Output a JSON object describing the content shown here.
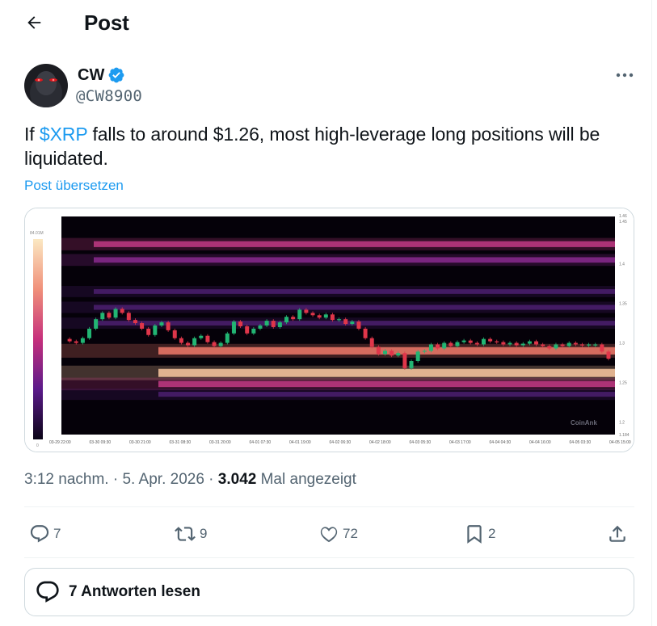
{
  "header": {
    "title": "Post",
    "back_icon": "arrow-left-icon"
  },
  "author": {
    "name": "CW",
    "handle": "@CW8900",
    "verified_color": "#1d9bf0"
  },
  "tweet": {
    "text_before": "If ",
    "cashtag": "$XRP",
    "text_after": " falls to around $1.26, most high-leverage long positions will be liquidated.",
    "translate_label": "Post übersetzen"
  },
  "chart_data": {
    "type": "heatmap",
    "watermark": "CoinAnk",
    "colorbar_max_label": "84.01M",
    "colorbar_min_label": "0",
    "x_tick_labels": [
      "03-29 22:00",
      "03-30 09:30",
      "03-30 21:00",
      "03-31 08:30",
      "03-31 20:00",
      "04-01 07:30",
      "04-01 19:00",
      "04-02 06:30",
      "04-02 18:00",
      "04-03 05:30",
      "04-03 17:00",
      "04-04 04:30",
      "04-04 16:00",
      "04-05 03:30",
      "04-05 15:00"
    ],
    "y_tick_labels": [
      "1.46",
      "1.45",
      "1.4",
      "1.35",
      "1.3",
      "1.25",
      "1.2",
      "1.184"
    ],
    "ylim": [
      1.184,
      1.46
    ],
    "price_series": [
      1.305,
      1.302,
      1.3,
      1.306,
      1.318,
      1.33,
      1.338,
      1.332,
      1.343,
      1.338,
      1.329,
      1.325,
      1.318,
      1.31,
      1.322,
      1.326,
      1.316,
      1.306,
      1.3,
      1.297,
      1.306,
      1.309,
      1.301,
      1.296,
      1.3,
      1.312,
      1.327,
      1.321,
      1.312,
      1.318,
      1.322,
      1.328,
      1.32,
      1.326,
      1.333,
      1.33,
      1.342,
      1.338,
      1.335,
      1.332,
      1.336,
      1.329,
      1.33,
      1.324,
      1.327,
      1.318,
      1.306,
      1.295,
      1.286,
      1.29,
      1.284,
      1.287,
      1.268,
      1.277,
      1.289,
      1.29,
      1.298,
      1.293,
      1.3,
      1.296,
      1.301,
      1.303,
      1.3,
      1.298,
      1.305,
      1.302,
      1.301,
      1.298,
      1.3,
      1.297,
      1.299,
      1.302,
      1.298,
      1.296,
      1.293,
      1.298,
      1.296,
      1.3,
      1.298,
      1.297,
      1.298,
      1.298,
      1.289,
      1.28
    ],
    "liquidation_bands": [
      {
        "price": 1.425,
        "intensity": 0.55
      },
      {
        "price": 1.405,
        "intensity": 0.45
      },
      {
        "price": 1.365,
        "intensity": 0.3
      },
      {
        "price": 1.345,
        "intensity": 0.35
      },
      {
        "price": 1.325,
        "intensity": 0.3
      },
      {
        "price": 1.29,
        "intensity": 0.85
      },
      {
        "price": 1.262,
        "intensity": 1.0
      },
      {
        "price": 1.248,
        "intensity": 0.6
      },
      {
        "price": 1.235,
        "intensity": 0.35
      }
    ]
  },
  "meta": {
    "time": "3:12 nachm.",
    "date": "5. Apr. 2026",
    "views": "3.042",
    "views_label": "Mal angezeigt"
  },
  "actions": {
    "replies": "7",
    "reposts": "9",
    "likes": "72",
    "bookmarks": "2"
  },
  "read_replies": {
    "label": "7 Antworten lesen"
  },
  "colors": {
    "accent": "#1d9bf0",
    "text": "#0f1419",
    "muted": "#536471"
  }
}
